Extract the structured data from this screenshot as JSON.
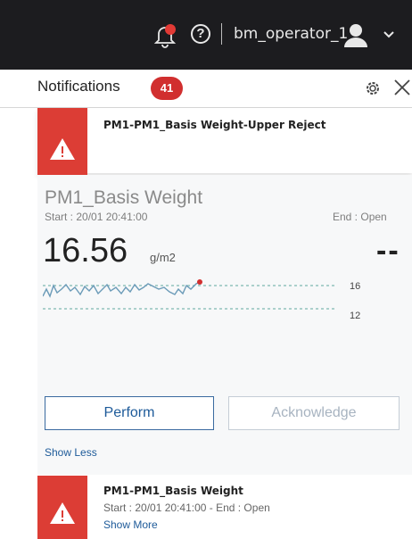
{
  "topbar": {
    "username": "bm_operator_1"
  },
  "header": {
    "title": "Notifications",
    "count": "41"
  },
  "alerts": [
    {
      "title": "PM1-PM1_Basis Weight-Upper Reject"
    },
    {
      "title": "PM1-PM1_Basis Weight",
      "subtitle": "Start : 20/01 20:41:00  -  End : Open",
      "show_more": "Show More"
    }
  ],
  "detail": {
    "tag": "PM1_Basis Weight",
    "start": "Start : 20/01 20:41:00",
    "end": "End : Open",
    "value": "16.56",
    "unit": "g/m2",
    "target": "--",
    "upper_limit_label": "16",
    "lower_limit_label": "12",
    "perform_label": "Perform",
    "acknowledge_label": "Acknowledge",
    "show_less": "Show Less"
  },
  "colors": {
    "alert_red": "#dc3d35",
    "link_blue": "#1d5a99",
    "badge_red": "#d12f2f",
    "topbar": "#1c1c1f"
  },
  "icons": [
    "bell-alert-icon",
    "help-icon",
    "user-avatar-icon",
    "chevron-down-icon",
    "gear-icon",
    "close-icon",
    "warning-triangle-icon"
  ]
}
